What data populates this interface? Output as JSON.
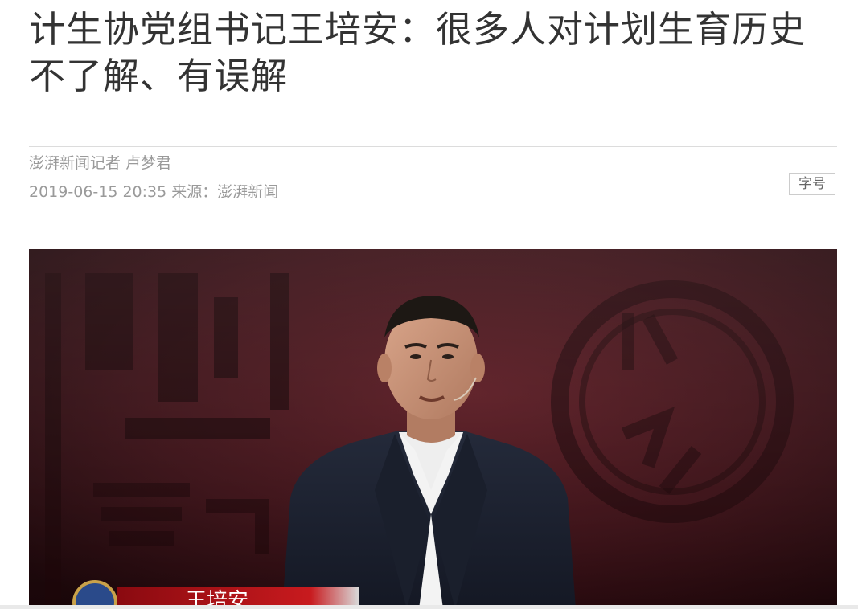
{
  "article": {
    "headline": "计生协党组书记王培安：很多人对计划生育历史不了解、有误解",
    "author": "澎湃新闻记者 卢梦君",
    "datetime": "2019-06-15 20:35",
    "source_label": "来源：",
    "source_name": "澎湃新闻"
  },
  "toolbar": {
    "font_size_label": "字号"
  },
  "hero_image": {
    "caption_fragment": "王培安"
  },
  "colors": {
    "headline": "#333333",
    "meta": "#9a9a9a",
    "divider": "#dcdcdc",
    "stage_bg": "#2a0c10",
    "suit": "#1c2130"
  }
}
